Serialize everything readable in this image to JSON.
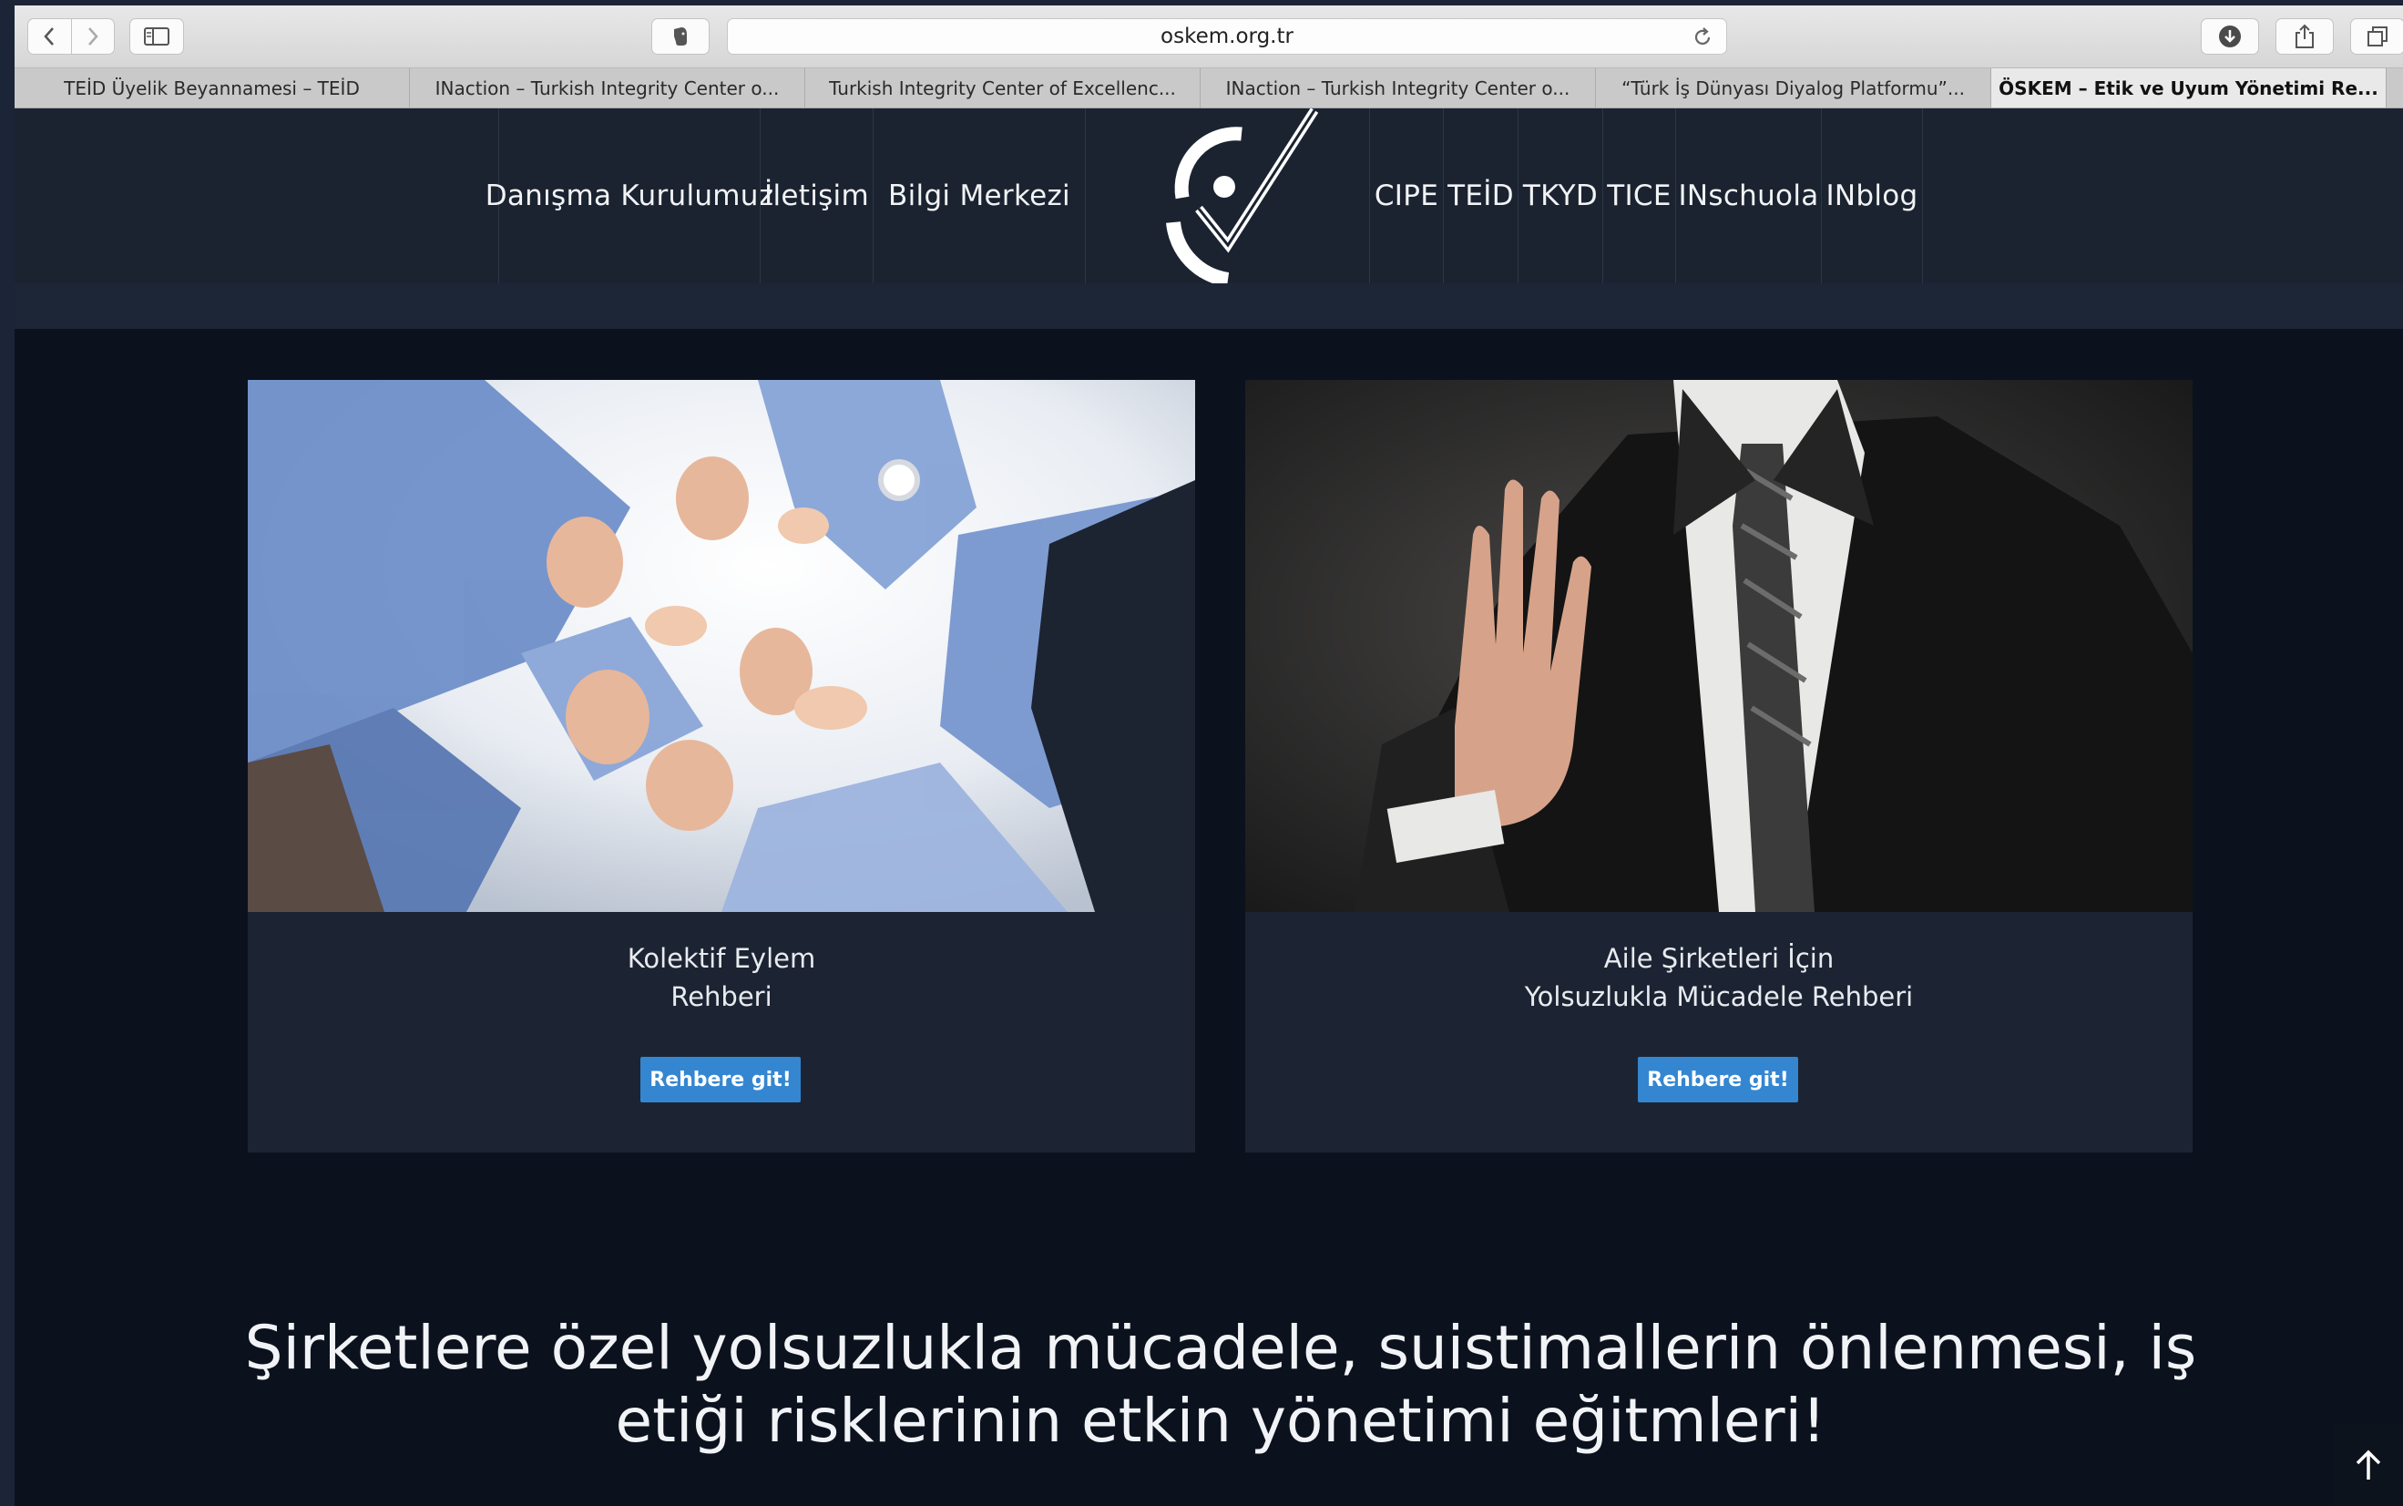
{
  "browser": {
    "url": "oskem.org.tr",
    "tabs": [
      {
        "label": "TEİD Üyelik Beyannamesi – TEİD",
        "active": false
      },
      {
        "label": "INaction – Turkish Integrity Center o...",
        "active": false
      },
      {
        "label": "Turkish Integrity Center of Excellenc...",
        "active": false
      },
      {
        "label": "INaction – Turkish Integrity Center o...",
        "active": false
      },
      {
        "label": "“Türk İş Dünyası Diyalog Platformu”...",
        "active": false
      },
      {
        "label": "ÖSKEM – Etik ve Uyum Yönetimi Re...",
        "active": true
      }
    ]
  },
  "site_nav": {
    "left": [
      "Danışma Kurulumuz",
      "İletişim",
      "Bilgi Merkezi"
    ],
    "right": [
      "CIPE",
      "TEİD",
      "TKYD",
      "TICE",
      "INschuola",
      "INblog"
    ]
  },
  "cards": [
    {
      "title_line1": "Kolektif Eylem",
      "title_line2": "Rehberi",
      "button": "Rehbere git!"
    },
    {
      "title_line1": "Aile Şirketleri İçin",
      "title_line2": "Yolsuzlukla Mücadele Rehberi",
      "button": "Rehbere git!"
    }
  ],
  "headline": {
    "line1": "Şirketlere özel yolsuzlukla mücadele, suistimallerin önlenmesi, iş",
    "line2": "etiği risklerinin etkin yönetimi eğitmleri!"
  },
  "colors": {
    "page_bg": "#0b121e",
    "header_bg": "#1b2331",
    "card_bg": "#1c2433",
    "button_blue": "#3486d1"
  }
}
